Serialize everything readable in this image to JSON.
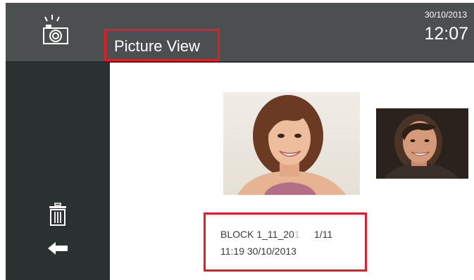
{
  "header": {
    "camera_button_icon": "camera-flash-icon",
    "title": "Picture View",
    "date": "30/10/2013",
    "time": "12:07"
  },
  "sidebar": {
    "delete_icon": "trash-icon",
    "back_icon": "back-arrow-icon"
  },
  "viewer": {
    "current_photo": "woman-portrait",
    "next_photo": "man-portrait",
    "file_name_dark": "BLOCK 1_11_20",
    "file_name_faded": "1",
    "index": "1/11",
    "captured": "11:19 30/10/2013"
  },
  "colors": {
    "header_bg": "#4b4f4f",
    "sidebar_bg": "#2b3130",
    "highlight": "#e11d2a",
    "text_light": "#ffffff",
    "text_dark": "#3a3a3a"
  }
}
